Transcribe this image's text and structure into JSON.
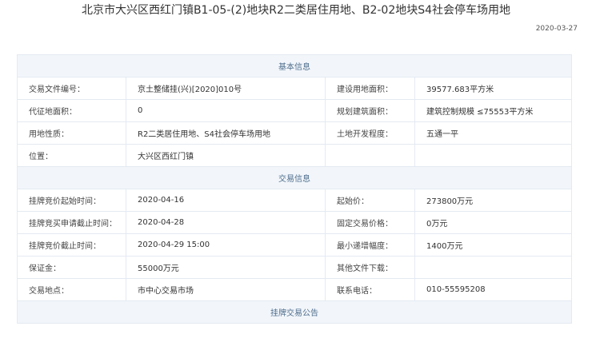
{
  "header": {
    "title": "北京市大兴区西红门镇B1-05-(2)地块R2二类居住用地、B2-02地块S4社会停车场用地",
    "date": "2020-03-27"
  },
  "sections": {
    "basic": {
      "title": "基本信息",
      "rows": [
        {
          "l1": "交易文件编号：",
          "v1": "京土整储挂(兴)[2020]010号",
          "l2": "建设用地面积：",
          "v2": "39577.683平方米"
        },
        {
          "l1": "代征地面积：",
          "v1": "0",
          "l2": "规划建筑面积：",
          "v2": "建筑控制规模 ≤75553平方米"
        },
        {
          "l1": "用地性质：",
          "v1": "R2二类居住用地、S4社会停车场用地",
          "l2": "土地开发程度：",
          "v2": "五通一平"
        },
        {
          "l1": "位置：",
          "v1": "大兴区西红门镇",
          "l2": "",
          "v2": ""
        }
      ]
    },
    "trade": {
      "title": "交易信息",
      "rows": [
        {
          "l1": "挂牌竞价起始时间：",
          "v1": "2020-04-16",
          "l2": "起始价：",
          "v2": "273800万元"
        },
        {
          "l1": "挂牌竞买申请截止时间：",
          "v1": "2020-04-28",
          "l2": "固定交易价格：",
          "v2": "0万元"
        },
        {
          "l1": "挂牌竞价截止时间：",
          "v1": "2020-04-29 15:00",
          "l2": "最小递增幅度：",
          "v2": "1400万元"
        },
        {
          "l1": "保证金：",
          "v1": "55000万元",
          "l2": "其他文件下载：",
          "v2": ""
        },
        {
          "l1": "交易地点：",
          "v1": "市中心交易市场",
          "l2": "联系电话：",
          "v2": "010-55595208"
        }
      ]
    },
    "notice": {
      "title": "挂牌交易公告"
    }
  }
}
